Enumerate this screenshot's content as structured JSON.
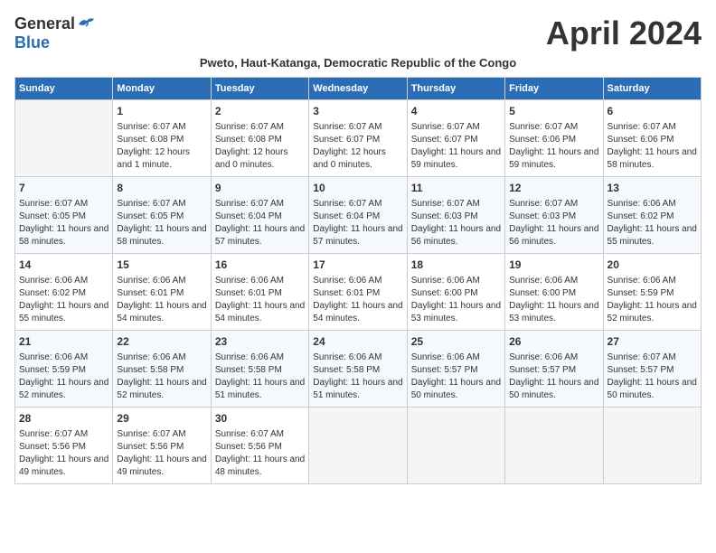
{
  "header": {
    "logo_general": "General",
    "logo_blue": "Blue",
    "month_title": "April 2024",
    "subtitle": "Pweto, Haut-Katanga, Democratic Republic of the Congo"
  },
  "weekdays": [
    "Sunday",
    "Monday",
    "Tuesday",
    "Wednesday",
    "Thursday",
    "Friday",
    "Saturday"
  ],
  "weeks": [
    [
      {
        "day": "",
        "sunrise": "",
        "sunset": "",
        "daylight": ""
      },
      {
        "day": "1",
        "sunrise": "Sunrise: 6:07 AM",
        "sunset": "Sunset: 6:08 PM",
        "daylight": "Daylight: 12 hours and 1 minute."
      },
      {
        "day": "2",
        "sunrise": "Sunrise: 6:07 AM",
        "sunset": "Sunset: 6:08 PM",
        "daylight": "Daylight: 12 hours and 0 minutes."
      },
      {
        "day": "3",
        "sunrise": "Sunrise: 6:07 AM",
        "sunset": "Sunset: 6:07 PM",
        "daylight": "Daylight: 12 hours and 0 minutes."
      },
      {
        "day": "4",
        "sunrise": "Sunrise: 6:07 AM",
        "sunset": "Sunset: 6:07 PM",
        "daylight": "Daylight: 11 hours and 59 minutes."
      },
      {
        "day": "5",
        "sunrise": "Sunrise: 6:07 AM",
        "sunset": "Sunset: 6:06 PM",
        "daylight": "Daylight: 11 hours and 59 minutes."
      },
      {
        "day": "6",
        "sunrise": "Sunrise: 6:07 AM",
        "sunset": "Sunset: 6:06 PM",
        "daylight": "Daylight: 11 hours and 58 minutes."
      }
    ],
    [
      {
        "day": "7",
        "sunrise": "Sunrise: 6:07 AM",
        "sunset": "Sunset: 6:05 PM",
        "daylight": "Daylight: 11 hours and 58 minutes."
      },
      {
        "day": "8",
        "sunrise": "Sunrise: 6:07 AM",
        "sunset": "Sunset: 6:05 PM",
        "daylight": "Daylight: 11 hours and 58 minutes."
      },
      {
        "day": "9",
        "sunrise": "Sunrise: 6:07 AM",
        "sunset": "Sunset: 6:04 PM",
        "daylight": "Daylight: 11 hours and 57 minutes."
      },
      {
        "day": "10",
        "sunrise": "Sunrise: 6:07 AM",
        "sunset": "Sunset: 6:04 PM",
        "daylight": "Daylight: 11 hours and 57 minutes."
      },
      {
        "day": "11",
        "sunrise": "Sunrise: 6:07 AM",
        "sunset": "Sunset: 6:03 PM",
        "daylight": "Daylight: 11 hours and 56 minutes."
      },
      {
        "day": "12",
        "sunrise": "Sunrise: 6:07 AM",
        "sunset": "Sunset: 6:03 PM",
        "daylight": "Daylight: 11 hours and 56 minutes."
      },
      {
        "day": "13",
        "sunrise": "Sunrise: 6:06 AM",
        "sunset": "Sunset: 6:02 PM",
        "daylight": "Daylight: 11 hours and 55 minutes."
      }
    ],
    [
      {
        "day": "14",
        "sunrise": "Sunrise: 6:06 AM",
        "sunset": "Sunset: 6:02 PM",
        "daylight": "Daylight: 11 hours and 55 minutes."
      },
      {
        "day": "15",
        "sunrise": "Sunrise: 6:06 AM",
        "sunset": "Sunset: 6:01 PM",
        "daylight": "Daylight: 11 hours and 54 minutes."
      },
      {
        "day": "16",
        "sunrise": "Sunrise: 6:06 AM",
        "sunset": "Sunset: 6:01 PM",
        "daylight": "Daylight: 11 hours and 54 minutes."
      },
      {
        "day": "17",
        "sunrise": "Sunrise: 6:06 AM",
        "sunset": "Sunset: 6:01 PM",
        "daylight": "Daylight: 11 hours and 54 minutes."
      },
      {
        "day": "18",
        "sunrise": "Sunrise: 6:06 AM",
        "sunset": "Sunset: 6:00 PM",
        "daylight": "Daylight: 11 hours and 53 minutes."
      },
      {
        "day": "19",
        "sunrise": "Sunrise: 6:06 AM",
        "sunset": "Sunset: 6:00 PM",
        "daylight": "Daylight: 11 hours and 53 minutes."
      },
      {
        "day": "20",
        "sunrise": "Sunrise: 6:06 AM",
        "sunset": "Sunset: 5:59 PM",
        "daylight": "Daylight: 11 hours and 52 minutes."
      }
    ],
    [
      {
        "day": "21",
        "sunrise": "Sunrise: 6:06 AM",
        "sunset": "Sunset: 5:59 PM",
        "daylight": "Daylight: 11 hours and 52 minutes."
      },
      {
        "day": "22",
        "sunrise": "Sunrise: 6:06 AM",
        "sunset": "Sunset: 5:58 PM",
        "daylight": "Daylight: 11 hours and 52 minutes."
      },
      {
        "day": "23",
        "sunrise": "Sunrise: 6:06 AM",
        "sunset": "Sunset: 5:58 PM",
        "daylight": "Daylight: 11 hours and 51 minutes."
      },
      {
        "day": "24",
        "sunrise": "Sunrise: 6:06 AM",
        "sunset": "Sunset: 5:58 PM",
        "daylight": "Daylight: 11 hours and 51 minutes."
      },
      {
        "day": "25",
        "sunrise": "Sunrise: 6:06 AM",
        "sunset": "Sunset: 5:57 PM",
        "daylight": "Daylight: 11 hours and 50 minutes."
      },
      {
        "day": "26",
        "sunrise": "Sunrise: 6:06 AM",
        "sunset": "Sunset: 5:57 PM",
        "daylight": "Daylight: 11 hours and 50 minutes."
      },
      {
        "day": "27",
        "sunrise": "Sunrise: 6:07 AM",
        "sunset": "Sunset: 5:57 PM",
        "daylight": "Daylight: 11 hours and 50 minutes."
      }
    ],
    [
      {
        "day": "28",
        "sunrise": "Sunrise: 6:07 AM",
        "sunset": "Sunset: 5:56 PM",
        "daylight": "Daylight: 11 hours and 49 minutes."
      },
      {
        "day": "29",
        "sunrise": "Sunrise: 6:07 AM",
        "sunset": "Sunset: 5:56 PM",
        "daylight": "Daylight: 11 hours and 49 minutes."
      },
      {
        "day": "30",
        "sunrise": "Sunrise: 6:07 AM",
        "sunset": "Sunset: 5:56 PM",
        "daylight": "Daylight: 11 hours and 48 minutes."
      },
      {
        "day": "",
        "sunrise": "",
        "sunset": "",
        "daylight": ""
      },
      {
        "day": "",
        "sunrise": "",
        "sunset": "",
        "daylight": ""
      },
      {
        "day": "",
        "sunrise": "",
        "sunset": "",
        "daylight": ""
      },
      {
        "day": "",
        "sunrise": "",
        "sunset": "",
        "daylight": ""
      }
    ]
  ]
}
